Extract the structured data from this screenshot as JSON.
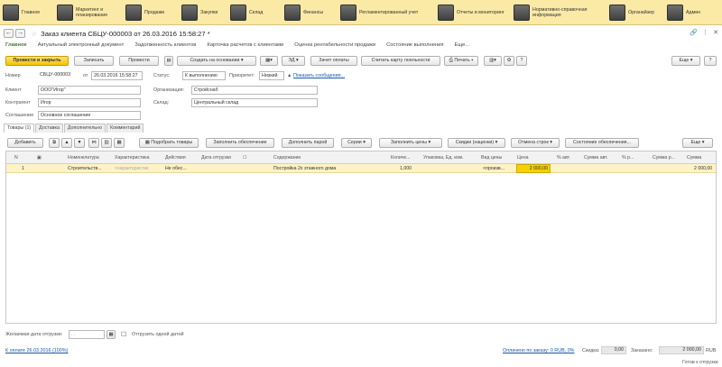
{
  "sections": [
    {
      "label": "Главное",
      "icon": "home-icon"
    },
    {
      "label": "Маркетинг и планирование",
      "icon": "marketing-icon"
    },
    {
      "label": "Продажи",
      "icon": "sales-icon"
    },
    {
      "label": "Закупки",
      "icon": "purchases-icon"
    },
    {
      "label": "Склад",
      "icon": "warehouse-icon"
    },
    {
      "label": "Финансы",
      "icon": "finance-icon"
    },
    {
      "label": "Регламентированный учет",
      "icon": "accounting-icon"
    },
    {
      "label": "Отчеты и мониторинг",
      "icon": "reports-icon"
    },
    {
      "label": "Нормативно-справочная информация",
      "icon": "reference-icon"
    },
    {
      "label": "Органайзер",
      "icon": "organizer-icon"
    },
    {
      "label": "Админ",
      "icon": "admin-icon"
    }
  ],
  "window": {
    "title": "Заказ клиента СБЦУ-000003 от 26.03.2016 15:58:27 *"
  },
  "doc_tabs": [
    "Главное",
    "Актуальный электронный документ",
    "Задолженность клиентов",
    "Карточка расчетов с клиентами",
    "Оценка рентабельности продажи",
    "Состояние выполнения",
    "Еще..."
  ],
  "toolbar": {
    "post_close": "Провести и закрыть",
    "write": "Записать",
    "post": "Провести",
    "create_based": "Создать на основании",
    "ed": "ЭД",
    "payment": "Зачет оплаты",
    "loyalty": "Считать карту лояльности",
    "print": "Печать",
    "more": "Еще"
  },
  "form": {
    "number_label": "Номер",
    "number": "СБЦУ-000003",
    "date_label": "от",
    "date": "26.03.2016 15:58:27",
    "status_label": "Статус:",
    "status": "К выполнению",
    "priority_label": "Приоритет:",
    "priority": "Низкий",
    "messages_link": "Показать сообщения...",
    "client_label": "Клиент",
    "client": "ООО\"Игор\"",
    "org_label": "Организация:",
    "org": "Стройснаб",
    "contractor_label": "Контрагент",
    "contractor": "Игор",
    "warehouse_label": "Склад:",
    "warehouse": "Центральный склад",
    "agreement_label": "Соглашение",
    "agreement": "Основное соглашение"
  },
  "subtabs": [
    "Товары (1)",
    "Доставка",
    "Дополнительно",
    "Комментарий"
  ],
  "goods_toolbar": {
    "add": "Добавить",
    "pick": "Подобрать товары",
    "fill_provision": "Заполнить обеспечение",
    "fill_by_group": "Дополнить парой",
    "series": "Серии",
    "fill_prices": "Заполнить цены",
    "discounts": "Скидки (наценки)",
    "cancel_rows": "Отмена строк",
    "provision_state": "Состояние обеспечения...",
    "more": "Еще"
  },
  "columns": [
    "N",
    "Номенклатура",
    "Характеристика",
    "Действия",
    "Дата отгрузки",
    "Содержание",
    "Количе...",
    "Упаковка, Ед. изм.",
    "Вид цены",
    "Цена",
    "% авт.",
    "Сумма авт.",
    "% р...",
    "Сумма р...",
    "Сумма"
  ],
  "rows": [
    {
      "n": "1",
      "item": "Строительств...",
      "characteristic": "<характеристик",
      "action": "Не обес...",
      "ship_date": "",
      "content": "Постройка 2х этажного дома",
      "qty": "1,000",
      "unit": "",
      "price_type": "<произв...",
      "price": "2 000,00",
      "auto_pct": "",
      "auto_sum": "",
      "man_pct": "",
      "man_sum": "",
      "sum": "2 000,00"
    }
  ],
  "bottom": {
    "ship_date_label": "Желаемая дата отгрузки:",
    "ship_date_value": "  .  .    ",
    "ship_one_date": "Отгрузить одной датой",
    "payment_link": "К оплате 26.03.2016 (100%)",
    "paid_link": "Оплачено по заказу: 0 RUB, 0%",
    "discount_label": "Скидка:",
    "discount": "0,00",
    "total_label": "Заказано:",
    "total": "2 000,00",
    "currency": "RUB",
    "ready": "Готов к отгрузке"
  }
}
